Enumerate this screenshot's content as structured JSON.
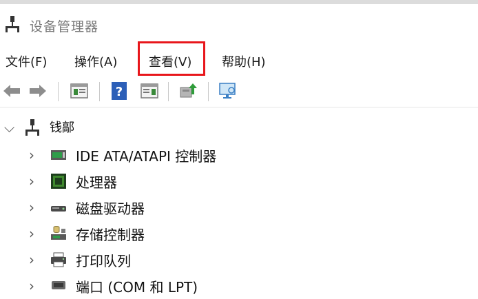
{
  "window": {
    "title": "设备管理器"
  },
  "menu": {
    "file": "文件(F)",
    "action": "操作(A)",
    "view": "查看(V)",
    "help": "帮助(H)"
  },
  "toolbar": {
    "icons": [
      "back-arrow-icon",
      "forward-arrow-icon",
      "properties-pane-icon",
      "help-icon",
      "action-pane-icon",
      "update-driver-icon",
      "monitor-scan-icon"
    ]
  },
  "tree": {
    "root": {
      "label": "钱鄗"
    },
    "items": [
      {
        "label": "IDE ATA/ATAPI 控制器",
        "icon": "ide-controller-icon"
      },
      {
        "label": "处理器",
        "icon": "processor-chip-icon"
      },
      {
        "label": "磁盘驱动器",
        "icon": "disk-drive-icon"
      },
      {
        "label": "存储控制器",
        "icon": "storage-controller-icon"
      },
      {
        "label": "打印队列",
        "icon": "printer-icon"
      },
      {
        "label": "端口 (COM 和 LPT)",
        "icon": "port-icon"
      }
    ]
  },
  "colors": {
    "highlight": "#e8161b"
  }
}
